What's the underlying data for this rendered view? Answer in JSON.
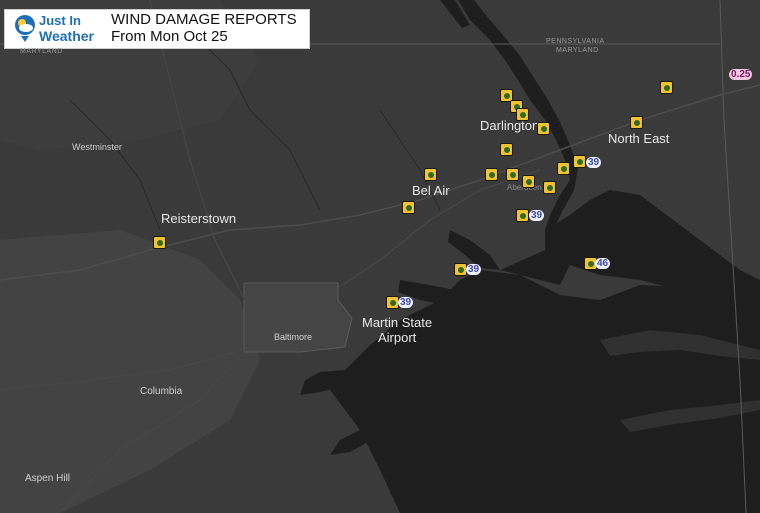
{
  "header": {
    "logo_line1": "Just In",
    "logo_line2": "Weather",
    "title": "WIND DAMAGE REPORTS",
    "subtitle": "From Mon Oct 25"
  },
  "places": {
    "darlington": "Darlington",
    "north_east": "North East",
    "bel_air": "Bel Air",
    "reisterstown": "Reisterstown",
    "martin_line1": "Martin State",
    "martin_line2": "Airport",
    "baltimore": "Baltimore",
    "westminster": "Westminster",
    "columbia": "Columbia",
    "aspen_hill": "Aspen Hill",
    "aberdeen": "Aberdeen",
    "maryland_nw": "MARYLAND",
    "pennsylvania": "PENNSYLVANIA",
    "maryland_ne": "MARYLAND"
  },
  "gusts": {
    "g1": "39",
    "g2": "39",
    "g3": "39",
    "g4": "46",
    "g5": "39",
    "g6": "0.25"
  },
  "colors": {
    "land": "#3a3a3a",
    "water": "#1e1e1e",
    "marker": "#f2c230",
    "header_bg": "#ffffff"
  },
  "icons": [
    "wind-damage-marker-icon",
    "logo-weather-icon"
  ]
}
